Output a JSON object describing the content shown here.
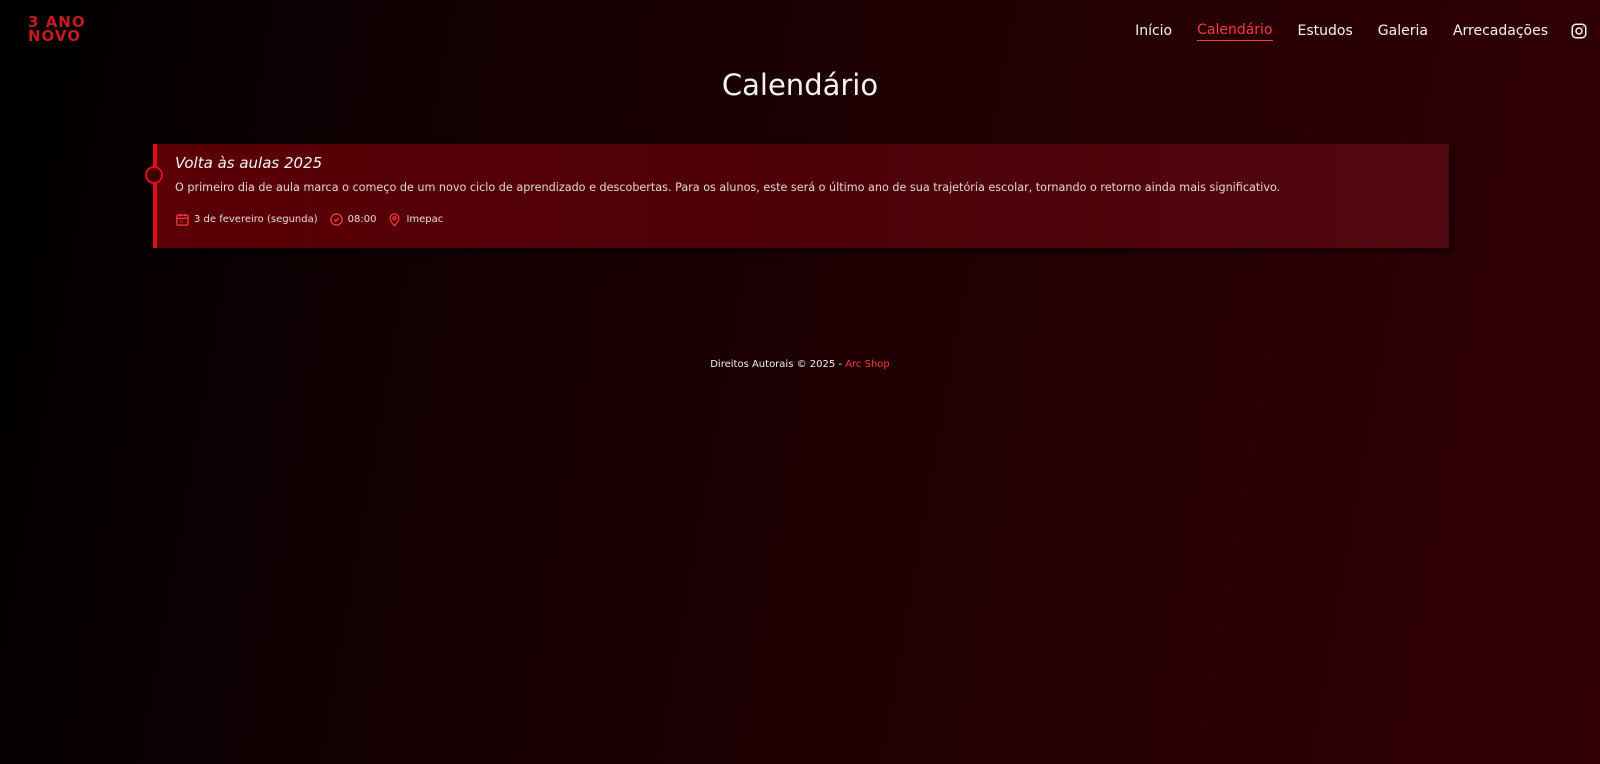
{
  "logo": {
    "line1": "3 ANO",
    "line2": "NOVO"
  },
  "nav": {
    "items": [
      {
        "label": "Início"
      },
      {
        "label": "Calendário"
      },
      {
        "label": "Estudos"
      },
      {
        "label": "Galeria"
      },
      {
        "label": "Arrecadações"
      }
    ],
    "active": "Calendário",
    "social_icon": "instagram-icon"
  },
  "page": {
    "title": "Calendário"
  },
  "events": [
    {
      "title": "Volta às aulas 2025",
      "description": "O primeiro dia de aula marca o começo de um novo ciclo de aprendizado e descobertas. Para os alunos, este será o último ano de sua trajetória escolar, tornando o retorno ainda mais significativo.",
      "date": "3 de fevereiro (segunda)",
      "time": "08:00",
      "location": "Imepac",
      "icons": {
        "date": "calendar-icon",
        "time": "clock-icon",
        "location": "map-pin-icon"
      }
    }
  ],
  "footer": {
    "text": "Direitos Autorais © 2025 - ",
    "link": "Arc Shop"
  },
  "colors": {
    "accent": "#e00f18",
    "link": "#ff3b45",
    "logo": "#c41a22"
  }
}
